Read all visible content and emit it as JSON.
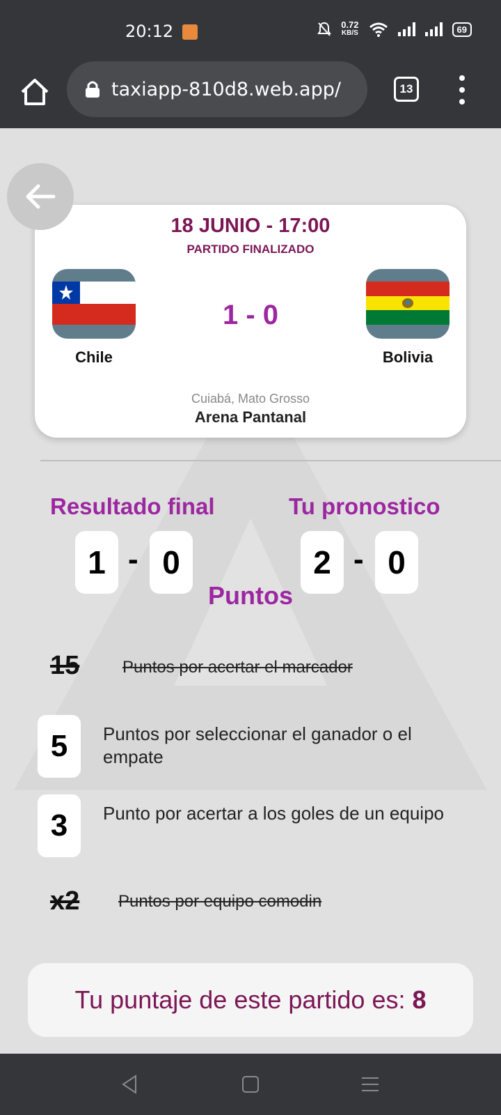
{
  "status_bar": {
    "time": "20:12",
    "net_speed_value": "0.72",
    "net_speed_unit": "KB/S",
    "battery": "69",
    "icons": [
      "app-notification-icon",
      "mute-icon",
      "wifi-icon",
      "signal-icon",
      "signal-icon",
      "battery-icon"
    ]
  },
  "browser": {
    "url": "taxiapp-810d8.web.app/",
    "tab_count": "13",
    "icons": [
      "home-icon",
      "lock-icon",
      "tabs-icon",
      "more-vert-icon"
    ]
  },
  "match": {
    "date": "18 JUNIO - 17:00",
    "status": "PARTIDO FINALIZADO",
    "home_team": "Chile",
    "away_team": "Bolivia",
    "score": "1 - 0",
    "city": "Cuiabá, Mato Grosso",
    "stadium": "Arena Pantanal"
  },
  "result": {
    "final_label": "Resultado final",
    "final_home": "1",
    "final_away": "0",
    "prediction_label": "Tu pronostico",
    "pred_home": "2",
    "pred_away": "0",
    "dash": "-"
  },
  "points": {
    "title": "Puntos",
    "rows": [
      {
        "value": "15",
        "text": "Puntos por acertar el marcador",
        "earned": false
      },
      {
        "value": "5",
        "text": "Puntos por seleccionar el ganador o el empate",
        "earned": true
      },
      {
        "value": "3",
        "text": "Punto por acertar a los goles de un equipo",
        "earned": true
      },
      {
        "value": "x2",
        "text": "Puntos por equipo comodin",
        "earned": false
      }
    ]
  },
  "total": {
    "label": "Tu puntaje de este partido es:",
    "value": "8"
  },
  "colors": {
    "accent_purple": "#9c27a0",
    "dark_purple": "#7b1655",
    "system_bar": "#35363a",
    "background": "#e0e0e0"
  }
}
